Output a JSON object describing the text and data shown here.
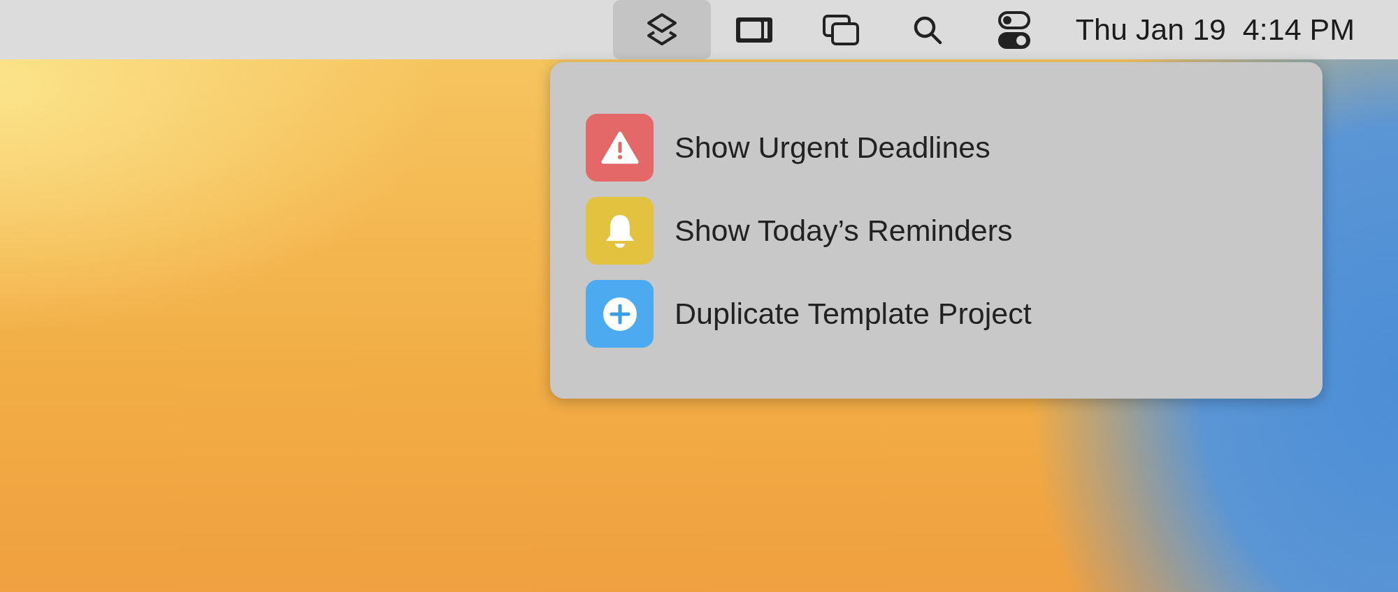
{
  "menu_bar": {
    "items": [
      {
        "kind": "shortcuts",
        "selected": true
      },
      {
        "kind": "stage",
        "selected": false
      },
      {
        "kind": "mirror",
        "selected": false
      },
      {
        "kind": "search",
        "selected": false
      },
      {
        "kind": "control",
        "selected": false
      }
    ],
    "clock": "Thu Jan 19  4:14 PM"
  },
  "menu": {
    "items": [
      {
        "kind": "warning",
        "color": "#e46868",
        "label": "Show Urgent Deadlines"
      },
      {
        "kind": "bell",
        "color": "#e2c23e",
        "label": "Show Today’s Reminders"
      },
      {
        "kind": "plus",
        "color": "#4caaf0",
        "label": "Duplicate Template Project"
      }
    ]
  }
}
